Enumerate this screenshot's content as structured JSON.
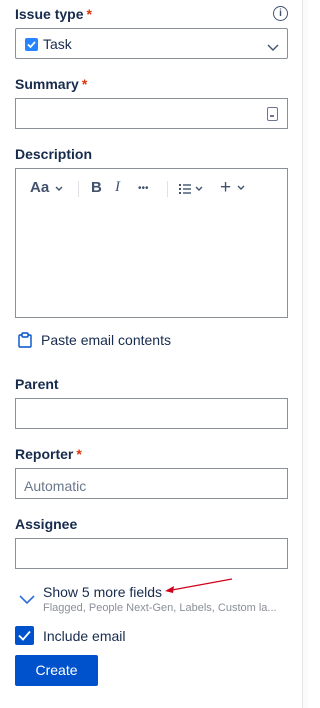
{
  "issue_type": {
    "label": "Issue type",
    "required_mark": "*",
    "value": "Task",
    "info_icon": "info-icon",
    "task_color": "#2684ff"
  },
  "summary": {
    "label": "Summary",
    "required_mark": "*",
    "value": "",
    "icon": "emoji-picker-icon"
  },
  "description": {
    "label": "Description",
    "toolbar": {
      "text_style": "Aa",
      "bold": "B",
      "italic": "I",
      "more": "•••",
      "list": "list-icon",
      "insert": "+"
    },
    "value": ""
  },
  "paste_email": {
    "label": "Paste email contents",
    "icon": "clipboard-icon"
  },
  "parent": {
    "label": "Parent",
    "value": ""
  },
  "reporter": {
    "label": "Reporter",
    "required_mark": "*",
    "placeholder": "Automatic"
  },
  "assignee": {
    "label": "Assignee",
    "value": ""
  },
  "more_fields": {
    "label": "Show 5 more fields",
    "sublabel": "Flagged, People Next-Gen, Labels, Custom la..."
  },
  "include_email": {
    "label": "Include email",
    "checked": true
  },
  "create_button": {
    "label": "Create"
  },
  "colors": {
    "primary": "#0052cc",
    "required": "#de350b",
    "annotation_arrow": "#d0021b"
  }
}
